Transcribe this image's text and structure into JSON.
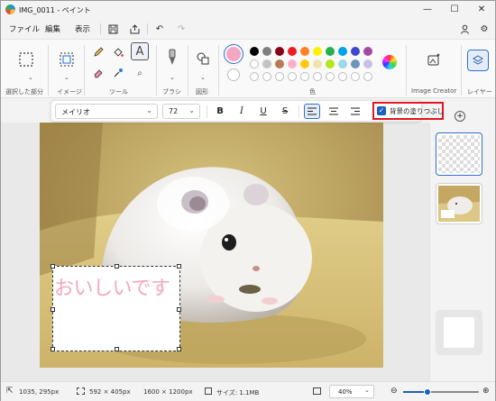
{
  "window": {
    "title": "IMG_0011 - ペイント"
  },
  "menu": {
    "file": "ファイル",
    "edit": "編集",
    "view": "表示"
  },
  "ribbon": {
    "groups": {
      "select": "選択した部分",
      "image": "イメージ",
      "tools": "ツール",
      "brushes": "ブラシ",
      "shapes": "図形",
      "colors": "色",
      "image_creator": "Image Creator",
      "layers": "レイヤー"
    },
    "primary_color": "#f4a7c0",
    "palette_row1": [
      "#000000",
      "#7f7f7f",
      "#880015",
      "#ed1c24",
      "#ff7f27",
      "#fff200",
      "#22b14c",
      "#00a2e8",
      "#3f48cc",
      "#a349a4"
    ],
    "palette_row2": [
      "#ffffff",
      "#c3c3c3",
      "#b97a57",
      "#ffaec9",
      "#ffc90e",
      "#efe4b0",
      "#b5e61d",
      "#99d9ea",
      "#7092be",
      "#c8bfe7"
    ]
  },
  "text_toolbar": {
    "font": "メイリオ",
    "size": "72",
    "fill_background_label": "背景の塗りつぶし",
    "fill_background_checked": true
  },
  "canvas": {
    "text_content": "おいしいです",
    "text_color": "#f4a7c0"
  },
  "status": {
    "cursor_pos": "1035, 295px",
    "selection_size": "592 × 405px",
    "image_size": "1600 × 1200px",
    "file_size": "サイズ: 1.1MB",
    "zoom": "40%",
    "zoom_fraction": 0.4
  }
}
